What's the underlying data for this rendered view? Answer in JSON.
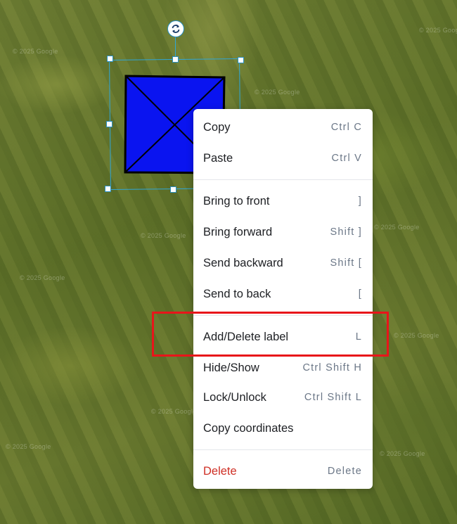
{
  "map": {
    "watermark": "© 2025 Google"
  },
  "colors": {
    "shape_fill": "#0a14f0",
    "selection": "#2fa6d8",
    "highlight": "#e8151a",
    "danger": "#cf2f25"
  },
  "context_menu": {
    "copy": {
      "label": "Copy",
      "shortcut": "Ctrl C"
    },
    "paste": {
      "label": "Paste",
      "shortcut": "Ctrl V"
    },
    "bring_to_front": {
      "label": "Bring to front",
      "shortcut": "]"
    },
    "bring_forward": {
      "label": "Bring forward",
      "shortcut": "Shift ]"
    },
    "send_backward": {
      "label": "Send backward",
      "shortcut": "Shift ["
    },
    "send_to_back": {
      "label": "Send to back",
      "shortcut": "["
    },
    "add_delete_label": {
      "label": "Add/Delete label",
      "shortcut": "L"
    },
    "hide_show": {
      "label": "Hide/Show",
      "shortcut": "Ctrl Shift H"
    },
    "lock_unlock": {
      "label": "Lock/Unlock",
      "shortcut": "Ctrl Shift L"
    },
    "copy_coordinates": {
      "label": "Copy coordinates",
      "shortcut": ""
    },
    "delete": {
      "label": "Delete",
      "shortcut": "Delete"
    }
  }
}
